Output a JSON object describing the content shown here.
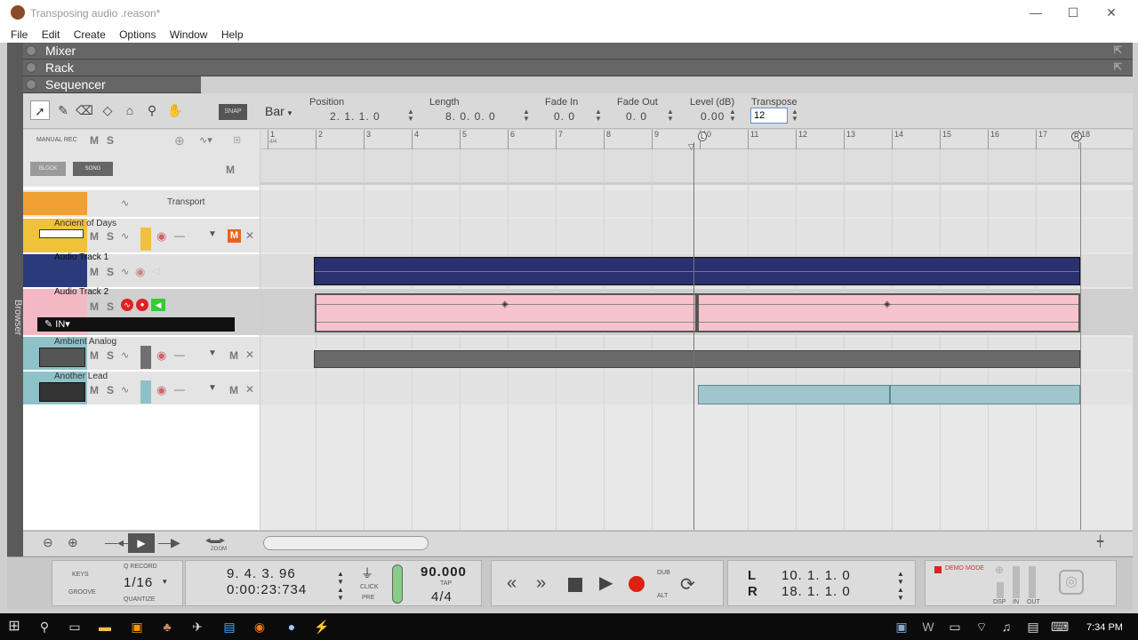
{
  "window": {
    "title": "Transposing audio .reason*",
    "minimize": "—",
    "maximize": "☐",
    "close": "✕"
  },
  "menu": [
    "File",
    "Edit",
    "Create",
    "Options",
    "Window",
    "Help"
  ],
  "browser_label": "Browser",
  "panels": {
    "mixer": "Mixer",
    "rack": "Rack",
    "sequencer": "Sequencer"
  },
  "toolbar": {
    "snap_label": "SNAP",
    "snap_value": "Bar",
    "position_label": "Position",
    "position_value": "2. 1. 1. 0",
    "length_label": "Length",
    "length_value": "8. 0. 0. 0",
    "fadein_label": "Fade In",
    "fadein_value": "0. 0",
    "fadeout_label": "Fade Out",
    "fadeout_value": "0. 0",
    "level_label": "Level (dB)",
    "level_value": "0.00",
    "transpose_label": "Transpose",
    "transpose_value": "12"
  },
  "tracklist": {
    "manual_rec": "MANUAL REC",
    "m": "M",
    "s": "S",
    "block": "BLOCK",
    "song": "SONG",
    "transport": "Transport",
    "in_label": "IN▾",
    "tracks": [
      {
        "name": "Ancient of Days",
        "color": "#f0c23a"
      },
      {
        "name": "Audio Track 1",
        "color": "#2a3a7a"
      },
      {
        "name": "Audio Track 2",
        "color": "#f4b8c4"
      },
      {
        "name": "Ambient Analog",
        "color": "#707070"
      },
      {
        "name": "Another Lead",
        "color": "#8fc1c8"
      }
    ]
  },
  "ruler": {
    "bars": [
      "1",
      "2",
      "3",
      "4",
      "5",
      "6",
      "7",
      "8",
      "9",
      "10",
      "11",
      "12",
      "13",
      "14",
      "15",
      "16",
      "17",
      "18"
    ],
    "sig": "4/4",
    "loop_left": "L",
    "loop_right": "R"
  },
  "bottombar": {
    "zoom_label": "ZOOM"
  },
  "transport": {
    "keys": "KEYS",
    "groove": "GROOVE",
    "q_record": "Q RECORD",
    "quantize_value": "1/16",
    "quantize": "QUANTIZE",
    "position": "9. 4. 3. 96",
    "time": "0:00:23:734",
    "click": "CLICK",
    "pre": "PRE",
    "tempo": "90.000",
    "tap": "TAP",
    "signature": "4/4",
    "dub": "DUB",
    "alt": "ALT",
    "l_label": "L",
    "l_value": "10. 1. 1. 0",
    "r_label": "R",
    "r_value": "18. 1. 1. 0",
    "demo_mode": "DEMO MODE",
    "dsp": "DSP",
    "in": "IN",
    "out": "OUT"
  },
  "taskbar": {
    "clock": "7:34 PM"
  }
}
